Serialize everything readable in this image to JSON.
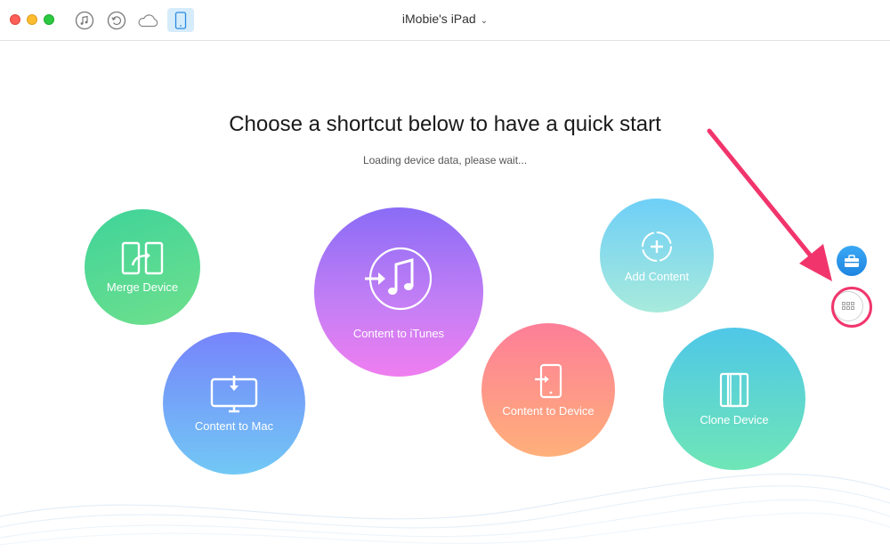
{
  "window": {
    "title": "iMobie's iPad"
  },
  "toolbar": {
    "buttons": [
      {
        "icon": "music-note-icon"
      },
      {
        "icon": "restore-icon"
      },
      {
        "icon": "cloud-icon"
      },
      {
        "icon": "ipad-icon",
        "active": true
      }
    ]
  },
  "main": {
    "headline": "Choose a shortcut below to have a quick start",
    "status": "Loading device data, please wait..."
  },
  "shortcuts": {
    "merge": {
      "label": "Merge Device"
    },
    "mac": {
      "label": "Content to Mac"
    },
    "itunes": {
      "label": "Content to iTunes"
    },
    "add": {
      "label": "Add Content"
    },
    "device": {
      "label": "Content to Device"
    },
    "clone": {
      "label": "Clone Device"
    }
  },
  "side_buttons": [
    {
      "icon": "toolbox-icon"
    },
    {
      "icon": "grid-icon"
    }
  ],
  "colors": {
    "highlight": "#f1356c",
    "accent": "#1f86e0"
  }
}
